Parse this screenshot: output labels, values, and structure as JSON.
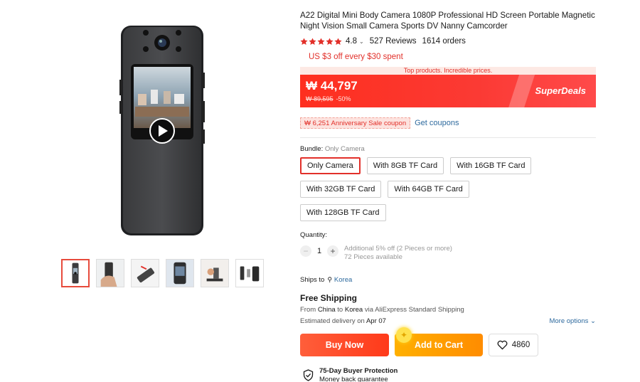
{
  "product": {
    "title": "A22 Digital Mini Body Camera 1080P Professional HD Screen Portable Magnetic Night Vision Small Camera Sports DV Nanny Camcorder",
    "rating": "4.8",
    "reviews": "527 Reviews",
    "orders": "1614 orders",
    "star_count": 5
  },
  "promo": {
    "text": "US $3 off every $30 spent"
  },
  "deal": {
    "banner": "Top products. Incredible prices.",
    "price": "₩ 44,797",
    "old_price": "₩ 89,595",
    "discount": "-50%",
    "brand": "SuperDeals"
  },
  "coupon": {
    "text": "₩ 6,251 Anniversary Sale coupon",
    "link": "Get coupons"
  },
  "bundle": {
    "label": "Bundle:",
    "selected": "Only Camera",
    "options": [
      "Only Camera",
      "With 8GB TF Card",
      "With 16GB TF Card",
      "With 32GB TF Card",
      "With 64GB TF Card",
      "With 128GB TF Card"
    ]
  },
  "quantity": {
    "label": "Quantity:",
    "value": "1",
    "minus": "−",
    "plus": "+",
    "discount_note": "Additional 5% off (2 Pieces or more)",
    "available": "72 Pieces available"
  },
  "shipping": {
    "ships_to_label": "Ships to",
    "country": "Korea",
    "free": "Free Shipping",
    "from_label": "From",
    "from": "China",
    "to_label": "to",
    "to": "Korea",
    "via": "via AliExpress Standard Shipping",
    "eta_label": "Estimated delivery on",
    "eta": "Apr 07",
    "more": "More options"
  },
  "actions": {
    "buy": "Buy Now",
    "cart": "Add to Cart",
    "wishlist_count": "4860"
  },
  "protection": {
    "title": "75-Day Buyer Protection",
    "subtitle": "Money back guarantee"
  },
  "gallery": {
    "thumb_count": 6,
    "active_index": 0
  },
  "colors": {
    "accent": "#e2302a",
    "deal_red": "#fe2f1f",
    "buy": "#ff4a2a",
    "cart": "#ff9d00",
    "link": "#2e6a9e"
  }
}
